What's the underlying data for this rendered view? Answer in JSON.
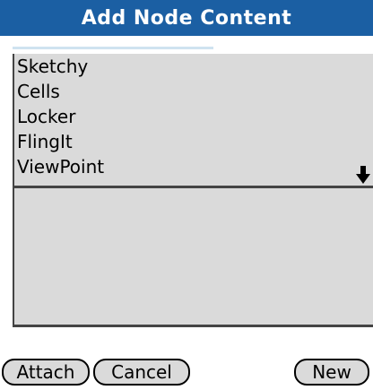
{
  "header": {
    "title": "Add Node Content"
  },
  "list": {
    "items": [
      {
        "label": "Sketchy"
      },
      {
        "label": "Cells"
      },
      {
        "label": "Locker"
      },
      {
        "label": "FlingIt"
      },
      {
        "label": "ViewPoint"
      }
    ],
    "scroll_icon": "arrow-down-icon"
  },
  "buttons": {
    "attach_label": "Attach",
    "cancel_label": "Cancel",
    "new_label": "New"
  },
  "colors": {
    "title_bar": "#1b5fa3",
    "list_background": "#dadada"
  }
}
